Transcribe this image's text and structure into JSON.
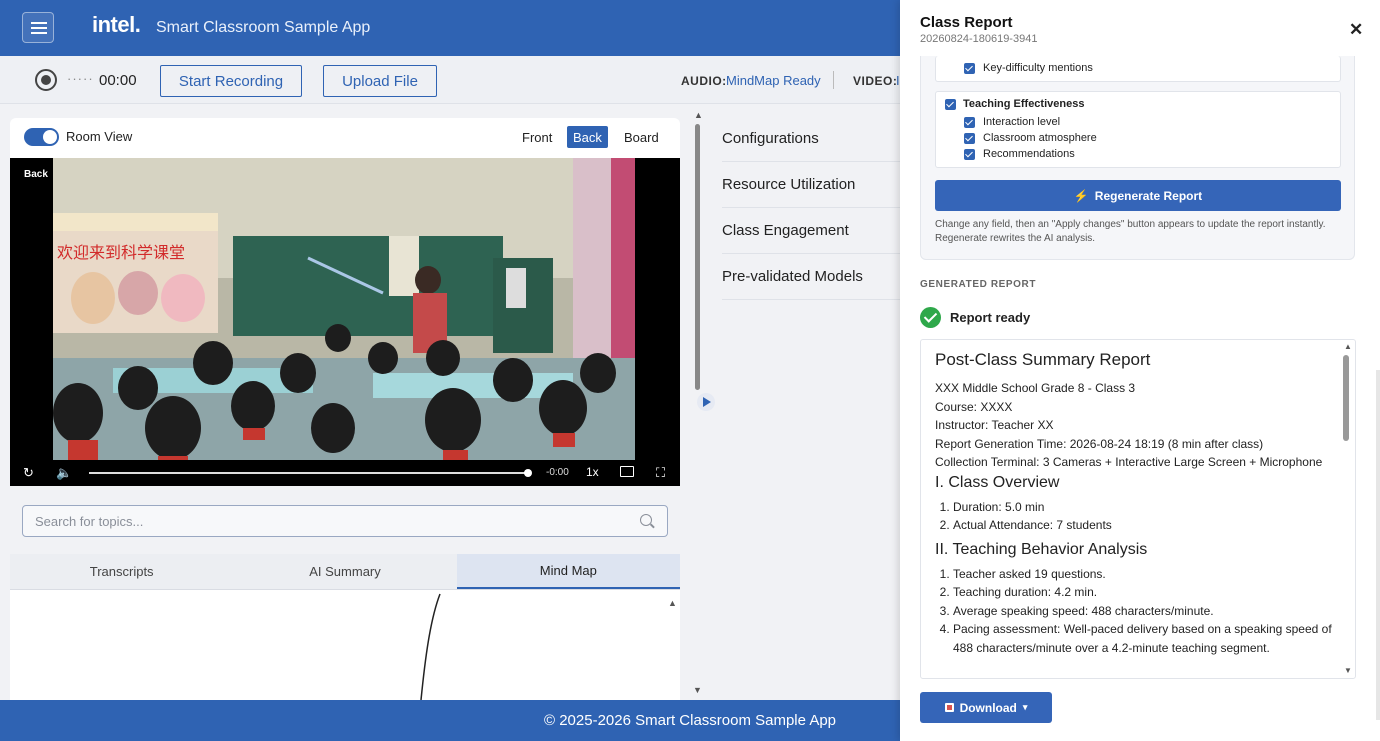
{
  "header": {
    "logo": "intel.",
    "title": "Smart Classroom Sample App"
  },
  "toolbar": {
    "dots": "·····",
    "time": "00:00",
    "start_recording": "Start Recording",
    "upload_file": "Upload File",
    "audio_label": "AUDIO:",
    "audio_status": "MindMap Ready",
    "video_label": "VIDEO:",
    "video_status": "I"
  },
  "video_panel": {
    "room_view_label": "Room View",
    "room_view_on": true,
    "views": [
      "Front",
      "Back",
      "Board"
    ],
    "active_view": "Back",
    "camera_label": "Back",
    "controls": {
      "remaining": "-0:00",
      "speed": "1x",
      "progress": 1.0
    },
    "banner_text": "欢迎来到科学课堂"
  },
  "search": {
    "placeholder": "Search for topics..."
  },
  "tabs": {
    "items": [
      "Transcripts",
      "AI Summary",
      "Mind Map"
    ],
    "active": "Mind Map"
  },
  "right_nav": {
    "items": [
      "Configurations",
      "Resource Utilization",
      "Class Engagement",
      "Pre-validated Models"
    ]
  },
  "footer": {
    "text": "© 2025-2026 Smart Classroom Sample App"
  },
  "drawer": {
    "title": "Class Report",
    "subtitle": "20260824-180619-3941",
    "close": "✕",
    "top_item": "Key-difficulty mentions",
    "group": {
      "title": "Teaching Effectiveness",
      "items": [
        "Interaction level",
        "Classroom atmosphere",
        "Recommendations"
      ]
    },
    "regenerate_button": "Regenerate Report",
    "regenerate_icon": "⚡",
    "hint": "Change any field, then an \"Apply changes\" button appears to update the report instantly. Regenerate rewrites the AI analysis.",
    "generated_label": "GENERATED REPORT",
    "ready_text": "Report ready",
    "download_button": "Download",
    "download_caret": "▾"
  },
  "report": {
    "title": "Post-Class Summary Report",
    "meta": [
      "XXX Middle School Grade 8 - Class 3",
      "Course: XXXX",
      "Instructor: Teacher XX",
      "Report Generation Time: 2026-08-24 18:19 (8 min after class)",
      "Collection Terminal: 3 Cameras + Interactive Large Screen + Microphone"
    ],
    "section1_title": "I. Class Overview",
    "section1_items": [
      "Duration: 5.0 min",
      "Actual Attendance: 7 students"
    ],
    "section2_title": "II. Teaching Behavior Analysis",
    "section2_items": [
      "Teacher asked 19 questions.",
      "Teaching duration: 4.2 min.",
      "Average speaking speed: 488 characters/minute.",
      "Pacing assessment: Well-paced delivery based on a speaking speed of 488 characters/minute over a 4.2-minute teaching segment."
    ]
  },
  "colors": {
    "brand": "#2f63b3",
    "success": "#2ea84a"
  }
}
